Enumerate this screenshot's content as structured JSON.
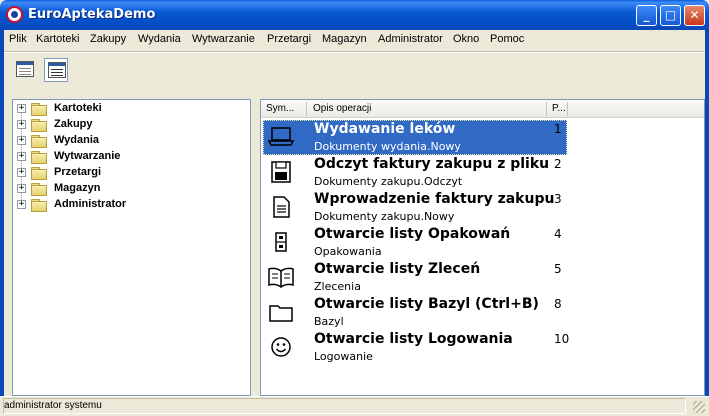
{
  "window": {
    "title": "EuroAptekaDemo",
    "minimize": "_",
    "maximize": "□",
    "close": "✕"
  },
  "menu": [
    {
      "label": "Plik"
    },
    {
      "label": "Kartoteki"
    },
    {
      "label": "Zakupy"
    },
    {
      "label": "Wydania"
    },
    {
      "label": "Wytwarzanie"
    },
    {
      "label": "Przetargi"
    },
    {
      "label": "Magazyn"
    },
    {
      "label": "Administrator"
    },
    {
      "label": "Okno"
    },
    {
      "label": "Pomoc"
    }
  ],
  "toolbar": [
    {
      "icon": "list-view-icon"
    },
    {
      "icon": "details-view-icon",
      "pressed": true
    }
  ],
  "tree": {
    "expander": "+",
    "items": [
      {
        "label": "Kartoteki",
        "icon": "folder-icon"
      },
      {
        "label": "Zakupy",
        "icon": "folder-icon"
      },
      {
        "label": "Wydania",
        "icon": "folder-icon"
      },
      {
        "label": "Wytwarzanie",
        "icon": "folder-icon"
      },
      {
        "label": "Przetargi",
        "icon": "folder-icon"
      },
      {
        "label": "Magazyn",
        "icon": "folder-icon"
      },
      {
        "label": "Administrator",
        "icon": "folder-icon"
      }
    ]
  },
  "list": {
    "columns": [
      "Sym...",
      "Opis operacji",
      "P..."
    ],
    "rows": [
      {
        "title": "Wydawanie leków",
        "desc": "Dokumenty wydania.Nowy",
        "num": "1",
        "icon": "laptop-icon",
        "selected": true
      },
      {
        "title": "Odczyt faktury zakupu z pliku",
        "desc": "Dokumenty zakupu.Odczyt",
        "num": "2",
        "icon": "floppy-disk-icon"
      },
      {
        "title": "Wprowadzenie faktury zakupu",
        "desc": "Dokumenty zakupu.Nowy",
        "num": "3",
        "icon": "document-icon"
      },
      {
        "title": "Otwarcie listy Opakowań",
        "desc": "Opakowania",
        "num": "4",
        "icon": "cabinet-icon"
      },
      {
        "title": "Otwarcie listy Zleceń",
        "desc": "Zlecenia",
        "num": "5",
        "icon": "open-book-icon"
      },
      {
        "title": "Otwarcie listy Bazyl (Ctrl+B)",
        "desc": "Bazyl",
        "num": "8",
        "icon": "folder-outline-icon"
      },
      {
        "title": "Otwarcie listy Logowania",
        "desc": "Logowanie",
        "num": "10",
        "icon": "smiley-icon"
      }
    ]
  },
  "status": {
    "text": "administrator systemu"
  },
  "colors": {
    "selection": "#316ac5",
    "titlebar": "#0a5ad4"
  }
}
